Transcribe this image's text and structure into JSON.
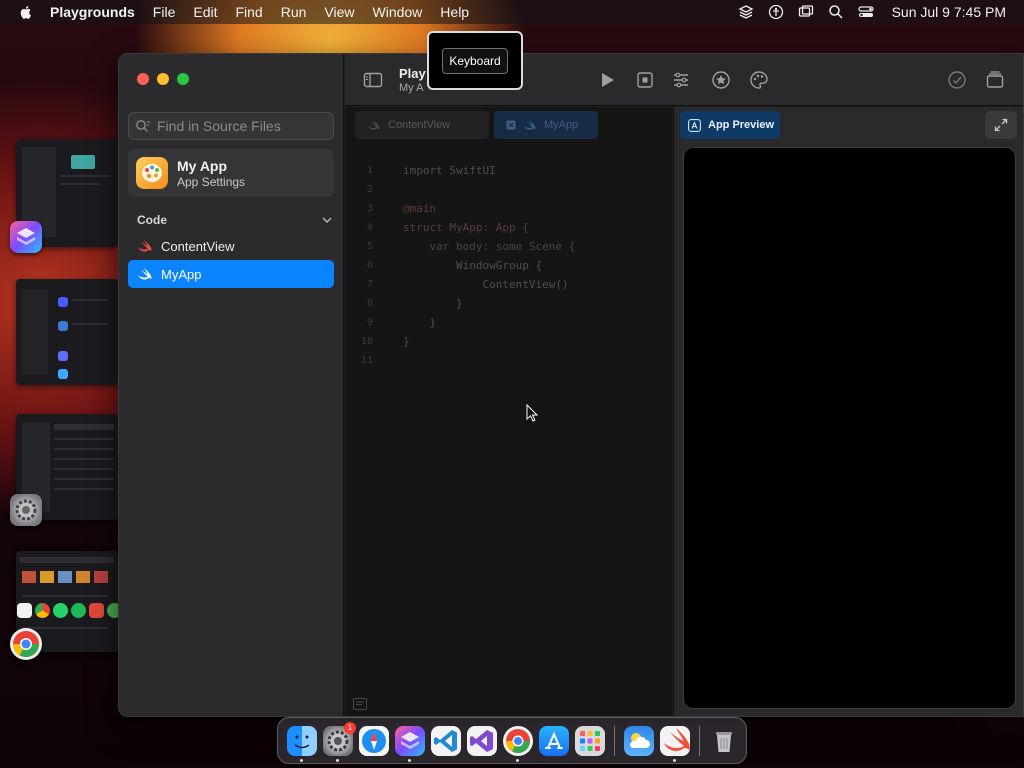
{
  "menubar": {
    "app_name": "Playgrounds",
    "items": [
      "File",
      "Edit",
      "Find",
      "Run",
      "View",
      "Window",
      "Help"
    ],
    "clock": "Sun Jul 9  7:45 PM"
  },
  "sidebar": {
    "search_placeholder": "Find in Source Files",
    "project_name": "My App",
    "project_subtitle": "App Settings",
    "section_title": "Code",
    "files": [
      {
        "label": "ContentView",
        "active": false
      },
      {
        "label": "MyApp",
        "active": true
      }
    ]
  },
  "toolbar": {
    "title": "Play",
    "subtitle": "My A",
    "tooltip": "Keyboard"
  },
  "editor": {
    "tabs": [
      {
        "label": "ContentView",
        "active": false
      },
      {
        "label": "MyApp",
        "active": true
      }
    ],
    "lines": [
      {
        "n": "1",
        "text": "import SwiftUI"
      },
      {
        "n": "2",
        "text": ""
      },
      {
        "n": "3",
        "text": "@main"
      },
      {
        "n": "4",
        "text": "struct MyApp: App {"
      },
      {
        "n": "5",
        "text": "    var body: some Scene {"
      },
      {
        "n": "6",
        "text": "        WindowGroup {"
      },
      {
        "n": "7",
        "text": "            ContentView()"
      },
      {
        "n": "8",
        "text": "        }"
      },
      {
        "n": "9",
        "text": "    }"
      },
      {
        "n": "10",
        "text": "}"
      },
      {
        "n": "11",
        "text": ""
      }
    ]
  },
  "preview": {
    "button_label": "App Preview"
  },
  "dock": {
    "settings_badge": "1"
  },
  "colors": {
    "accent": "#0a84ff",
    "close": "#ff5f57",
    "minimize": "#febc2e",
    "zoom": "#28c840"
  }
}
